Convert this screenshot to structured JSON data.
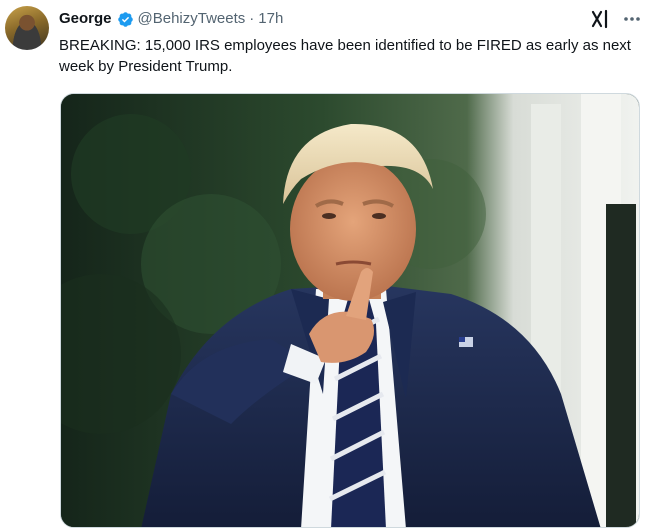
{
  "tweet": {
    "author_name": "George",
    "handle": "@BehizyTweets",
    "separator": "·",
    "time": "17h",
    "text": "BREAKING: 15,000 IRS employees have been identified to be FIRED as early as next week by President Trump."
  },
  "icons": {
    "verified": "verified-badge-icon",
    "grok": "grok-icon",
    "more": "more-options-icon",
    "avatar": "profile-avatar"
  },
  "colors": {
    "verified_blue": "#1d9bf0",
    "secondary_text": "#536471",
    "primary_text": "#0f1419"
  }
}
